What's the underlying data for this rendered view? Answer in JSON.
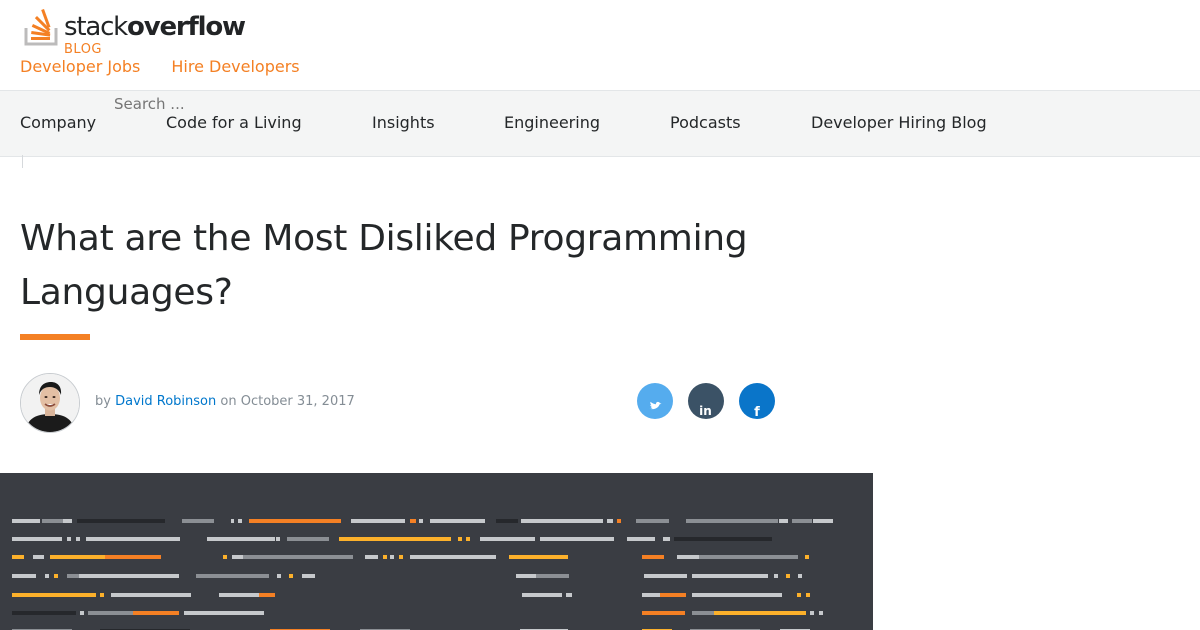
{
  "brand": {
    "word_light": "stack",
    "word_bold": "overflow",
    "sub": "BLOG",
    "accent": "#f48024",
    "icon": "stackoverflow-logo-icon"
  },
  "top_links": [
    "Developer Jobs",
    "Hire Developers"
  ],
  "search": {
    "placeholder": "Search ..."
  },
  "nav": [
    "Company",
    "Code for a Living",
    "Insights",
    "Engineering",
    "Podcasts",
    "Developer Hiring Blog"
  ],
  "article": {
    "title": "What are the Most Disliked Programming Languages?",
    "by": "by",
    "author": "David Robinson",
    "on": "on",
    "date": "October 31, 2017"
  },
  "share": [
    {
      "name": "twitter",
      "icon": "twitter-icon",
      "color": "#55acee"
    },
    {
      "name": "linkedin",
      "icon": "linkedin-icon",
      "color": "#3b5266"
    },
    {
      "name": "facebook",
      "icon": "facebook-icon",
      "color": "#0a75c9"
    }
  ],
  "colors": {
    "link_blue": "#0077cc",
    "hero_bg": "#3a3d43"
  }
}
